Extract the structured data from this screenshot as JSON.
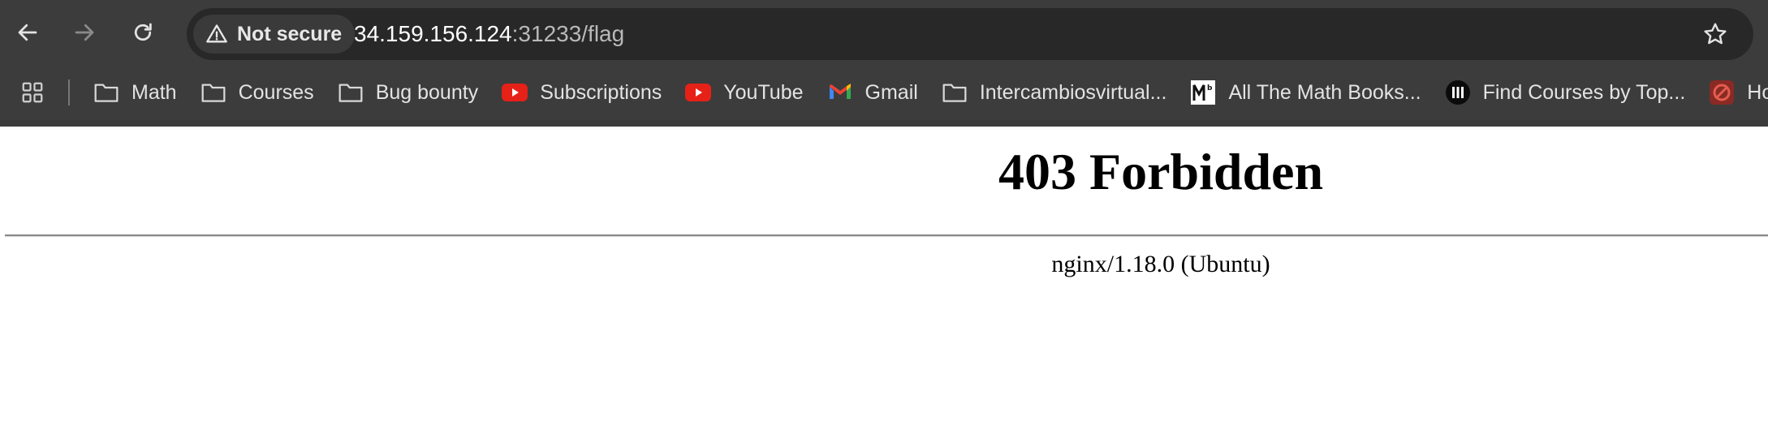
{
  "browser": {
    "address_bar": {
      "security_label": "Not secure",
      "url_host": "34.159.156.124",
      "url_rest": ":31233/flag"
    },
    "icons": {
      "back": "arrow-left-icon",
      "forward": "arrow-right-icon",
      "reload": "reload-icon",
      "security": "warning-triangle-icon",
      "bookmark_star": "star-icon",
      "apps": "apps-grid-icon"
    },
    "bookmarks": [
      {
        "label": "Math",
        "icon": "folder-icon"
      },
      {
        "label": "Courses",
        "icon": "folder-icon"
      },
      {
        "label": "Bug bounty",
        "icon": "folder-icon"
      },
      {
        "label": "Subscriptions",
        "icon": "youtube-icon"
      },
      {
        "label": "YouTube",
        "icon": "youtube-icon"
      },
      {
        "label": "Gmail",
        "icon": "gmail-icon"
      },
      {
        "label": "Intercambiosvirtual...",
        "icon": "folder-icon"
      },
      {
        "label": "All The Math Books...",
        "icon": "math-books-icon"
      },
      {
        "label": "Find Courses by Top...",
        "icon": "courses-site-icon"
      },
      {
        "label": "Hom",
        "icon": "home-site-icon"
      }
    ],
    "colors": {
      "chrome_bg": "#3c3c3c",
      "omnibox_bg": "#282828",
      "youtube_red": "#e62117",
      "page_bg": "#ffffff"
    }
  },
  "page": {
    "title": "403 Forbidden",
    "server_signature": "nginx/1.18.0 (Ubuntu)"
  }
}
